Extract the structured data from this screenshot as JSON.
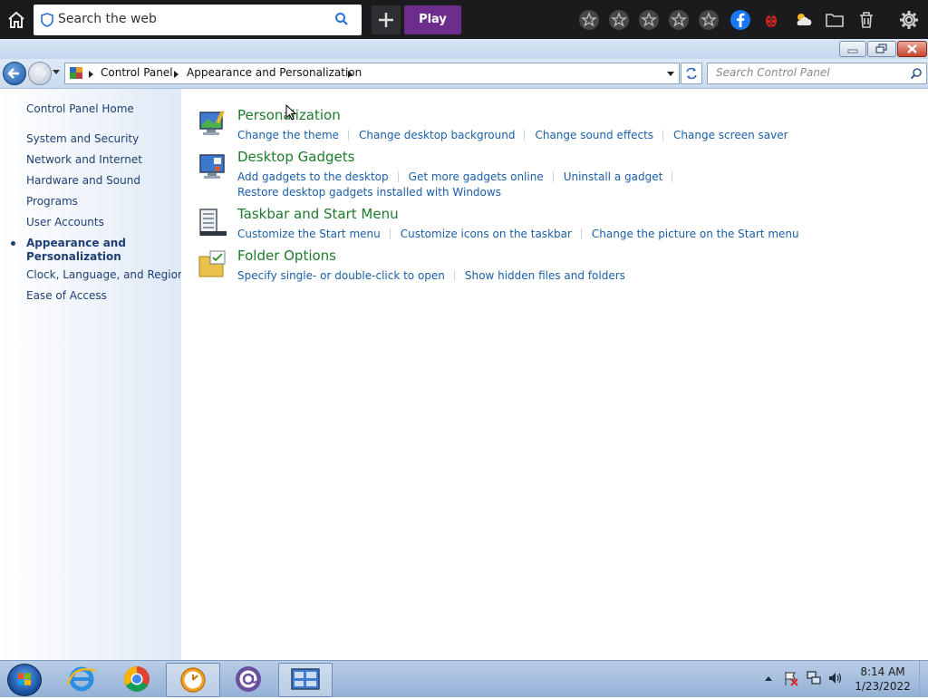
{
  "browser_toolbar": {
    "search_placeholder": "Search the web",
    "play_label": "Play",
    "icons": [
      "home-icon",
      "shield-icon",
      "search-icon",
      "plus-icon",
      "star-icon",
      "star-icon",
      "star-icon",
      "star-icon",
      "star-icon",
      "facebook-icon",
      "ladybug-icon",
      "weather-icon",
      "folder-icon",
      "trash-icon",
      "gear-icon"
    ],
    "play_color": "#6c2d8c"
  },
  "address_bar": {
    "breadcrumbs": [
      "Control Panel",
      "Appearance and Personalization"
    ],
    "search_placeholder": "Search Control Panel"
  },
  "left_pane": {
    "home": "Control Panel Home",
    "items": [
      "System and Security",
      "Network and Internet",
      "Hardware and Sound",
      "Programs",
      "User Accounts",
      "Appearance and Personalization",
      "Clock, Language, and Region",
      "Ease of Access"
    ],
    "active_index": 5
  },
  "categories": [
    {
      "title": "Personalization",
      "icon": "personalization-icon",
      "links": [
        "Change the theme",
        "Change desktop background",
        "Change sound effects",
        "Change screen saver"
      ],
      "links_row2": []
    },
    {
      "title": "Desktop Gadgets",
      "icon": "gadgets-icon",
      "links": [
        "Add gadgets to the desktop",
        "Get more gadgets online",
        "Uninstall a gadget"
      ],
      "links_row2": [
        "Restore desktop gadgets installed with Windows"
      ]
    },
    {
      "title": "Taskbar and Start Menu",
      "icon": "taskbar-icon",
      "links": [
        "Customize the Start menu",
        "Customize icons on the taskbar",
        "Change the picture on the Start menu"
      ],
      "links_row2": []
    },
    {
      "title": "Folder Options",
      "icon": "folder-options-icon",
      "links": [
        "Specify single- or double-click to open",
        "Show hidden files and folders"
      ],
      "links_row2": []
    }
  ],
  "taskbar": {
    "apps": [
      "start-orb",
      "internet-explorer-icon",
      "chrome-icon",
      "clock-app-icon",
      "at-sign-app-icon",
      "control-panel-icon"
    ],
    "clock_time": "8:14 AM",
    "clock_date": "1/23/2022"
  },
  "colors": {
    "link": "#1a5fa8",
    "category_title": "#1e7b2b",
    "nav_text": "#1e3f74"
  }
}
